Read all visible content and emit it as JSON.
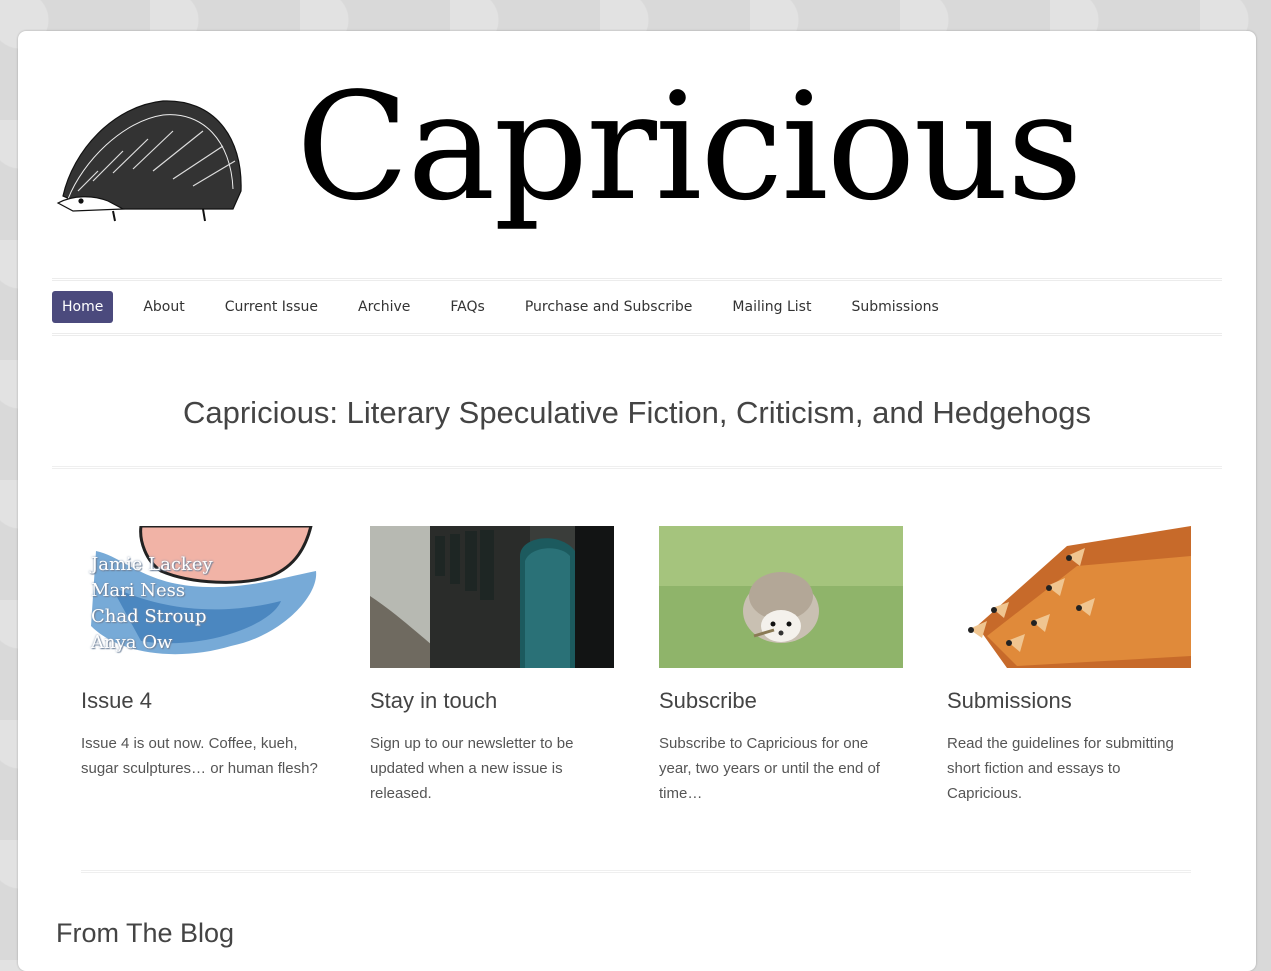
{
  "site": {
    "title": "Capricious",
    "logo": "hedgehog-engraving"
  },
  "nav": {
    "items": [
      {
        "label": "Home",
        "active": true
      },
      {
        "label": "About"
      },
      {
        "label": "Current Issue"
      },
      {
        "label": "Archive"
      },
      {
        "label": "FAQs"
      },
      {
        "label": "Purchase and Subscribe"
      },
      {
        "label": "Mailing List"
      },
      {
        "label": "Submissions"
      }
    ],
    "active_color": "#4b4a7d"
  },
  "tagline": "Capricious: Literary Speculative Fiction, Criticism, and Hedgehogs",
  "cards": [
    {
      "title": "Issue 4",
      "text": "Issue 4 is out now. Coffee, kueh, sugar sculptures… or human flesh?",
      "image_names": [
        "Jamie Lackey",
        "Mari Ness",
        "Chad Stroup",
        "Anya Ow"
      ]
    },
    {
      "title": "Stay in touch",
      "text": "Sign up to our newsletter to be updated when a new issue is released."
    },
    {
      "title": "Subscribe",
      "text": "Subscribe to Capricious for one year, two years or until the end of time…"
    },
    {
      "title": "Submissions",
      "text": "Read the guidelines for submitting short fiction and essays to Capricious."
    }
  ],
  "blog": {
    "title": "From The Blog"
  }
}
